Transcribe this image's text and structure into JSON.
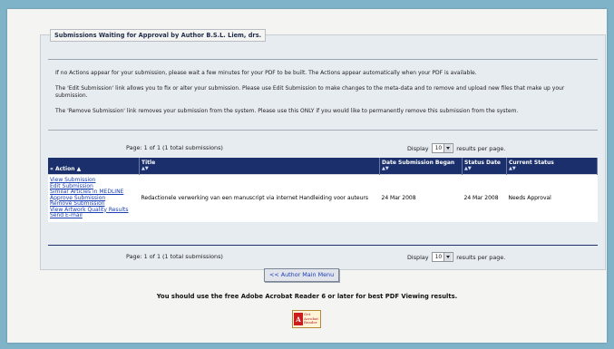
{
  "panel": {
    "legend": "Submissions Waiting for Approval by Author B.S.L. Liem, drs.",
    "info": [
      "If no Actions appear for your submission, please wait a few minutes for your PDF to be built. The Actions appear automatically when your PDF is available.",
      "The 'Edit Submission' link allows you to fix or alter your submission. Please use Edit Submission to make changes to the meta-data and to remove and upload new files that make up your submission.",
      "The 'Remove Submission' link removes your submission from the system. Please use this ONLY if you would like to permanently remove this submission from the system."
    ]
  },
  "pager": {
    "page_text": "Page: 1 of 1 (1 total submissions)",
    "display_label": "Display",
    "per_page_value": "10",
    "results_label": "results per page."
  },
  "table": {
    "headers": {
      "action": "« Action",
      "action_sort": "▲",
      "title": "Title",
      "date_began": "Date Submission Began",
      "status_date": "Status Date",
      "current_status": "Current Status",
      "sort_glyph": "▲▼"
    },
    "rows": [
      {
        "actions": [
          "View Submission",
          "Edit Submission",
          "Similar Articles in MEDLINE",
          "Approve Submission",
          "Remove Submission",
          "View Artwork Quality Results",
          "Send E-mail"
        ],
        "title": "Redactionele verwerking van een manuscript via internet Handleiding voor auteurs",
        "date_began": "24 Mar 2008",
        "status_date": "24 Mar 2008",
        "current_status": "Needs Approval"
      }
    ]
  },
  "buttons": {
    "author_main_menu": "<< Author Main Menu"
  },
  "footer": {
    "advice": "You should use the free Adobe Acrobat Reader 6 or later for best PDF Viewing results.",
    "badge_logo": "A",
    "badge_get": "Get",
    "badge_product": "Acrobat",
    "badge_reader": "Reader"
  }
}
